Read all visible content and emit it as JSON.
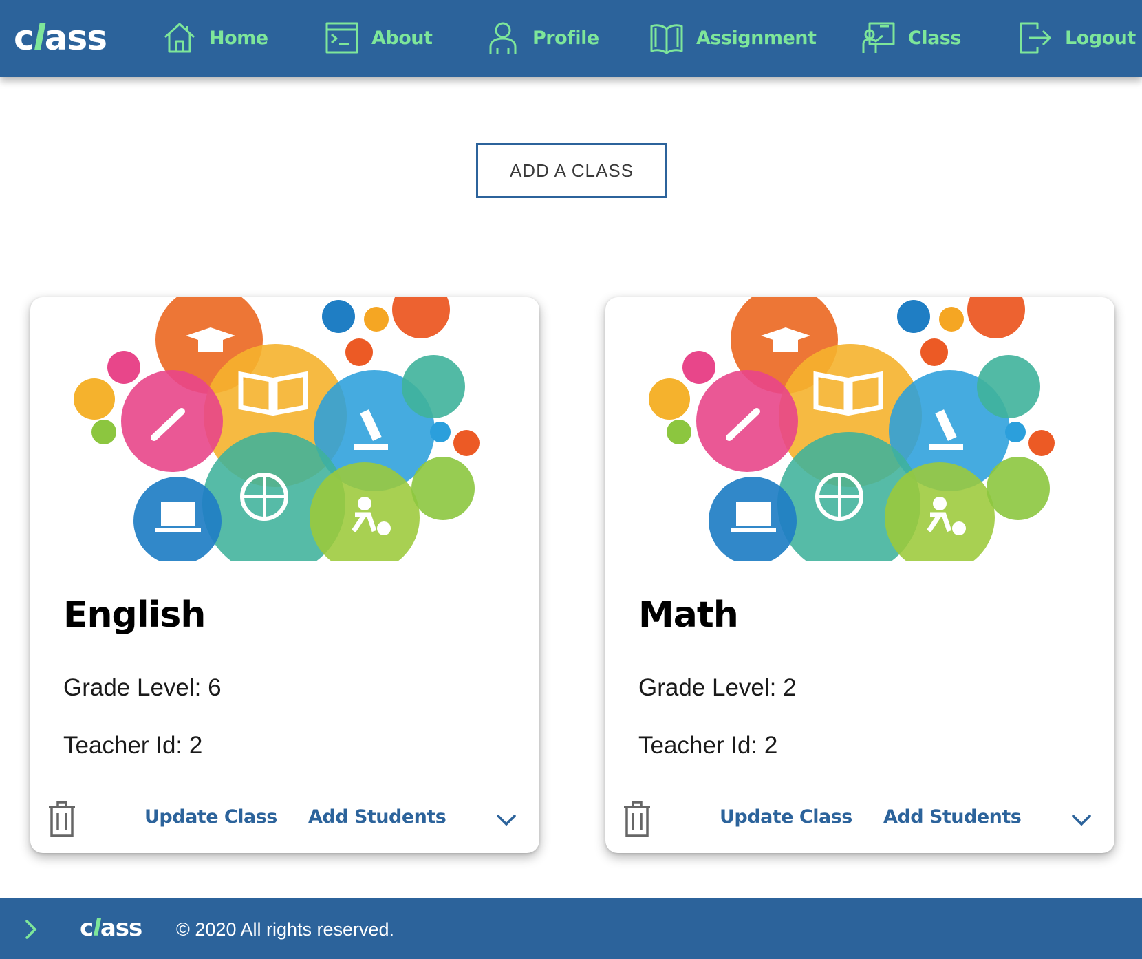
{
  "brand": {
    "logo_prefix": "c",
    "logo_accent": "l",
    "logo_suffix": "ass"
  },
  "colors": {
    "primary": "#2c639b",
    "accent": "#7ee69a",
    "background": "#ffffff"
  },
  "nav": [
    {
      "label": "Home",
      "icon": "home-icon"
    },
    {
      "label": "About",
      "icon": "terminal-window-icon"
    },
    {
      "label": "Profile",
      "icon": "user-icon"
    },
    {
      "label": "Assignment",
      "icon": "open-book-icon"
    },
    {
      "label": "Class",
      "icon": "teacher-board-icon"
    },
    {
      "label": "Logout",
      "icon": "logout-icon"
    }
  ],
  "add_class_label": "ADD A CLASS",
  "cards": [
    {
      "title": "English",
      "grade_level": "Grade Level: 6",
      "teacher_id": "Teacher Id: 2",
      "update_label": "Update Class",
      "add_students_label": "Add Students",
      "media": "education-subjects-illustration"
    },
    {
      "title": "Math",
      "grade_level": "Grade Level: 2",
      "teacher_id": "Teacher Id: 2",
      "update_label": "Update Class",
      "add_students_label": "Add Students",
      "media": "education-subjects-illustration"
    }
  ],
  "footer": {
    "copyright": "© 2020 All rights reserved."
  }
}
